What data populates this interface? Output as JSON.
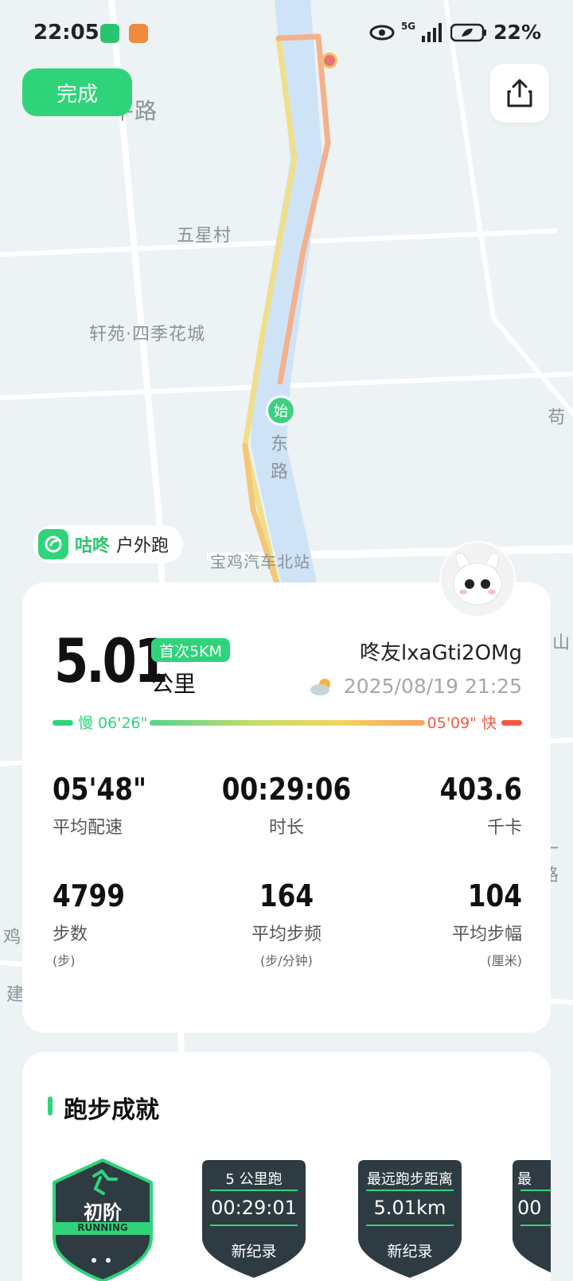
{
  "status_bar": {
    "time": "22:05",
    "network": "5G",
    "battery": "22%",
    "app_icon_1": "wechat-like-green-icon",
    "app_icon_2": "taobao-like-orange-icon"
  },
  "top": {
    "done_label": "完成",
    "share_icon": "share-icon"
  },
  "map": {
    "labels": [
      "平路",
      "五星村",
      "轩苑·四季花城",
      "东",
      "路",
      "宝鸡汽车北站",
      "苟",
      "山",
      "十路",
      "鸡",
      "建"
    ],
    "start_marker": "始"
  },
  "brand": {
    "name": "咕咚",
    "activity": "户外跑"
  },
  "summary": {
    "distance": "5.01",
    "badge": "首次5KM",
    "unit": "公里",
    "username": "咚友lxaGti2OMg",
    "datetime": "2025/08/19 21:25",
    "weather_icon": "partly-cloudy-icon",
    "pace_slow": "慢 06'26\"",
    "pace_fast": "05'09\" 快"
  },
  "stats": [
    {
      "value": "05'48\"",
      "label": "平均配速",
      "sub": ""
    },
    {
      "value": "00:29:06",
      "label": "时长",
      "sub": ""
    },
    {
      "value": "403.6",
      "label": "千卡",
      "sub": ""
    },
    {
      "value": "4799",
      "label": "步数",
      "sub": "(步)"
    },
    {
      "value": "164",
      "label": "平均步频",
      "sub": "(步/分钟)"
    },
    {
      "value": "104",
      "label": "平均步幅",
      "sub": "(厘米)"
    }
  ],
  "achievements": {
    "title": "跑步成就",
    "items": [
      {
        "top": "",
        "mid": "初阶",
        "bot": "RUNNING"
      },
      {
        "top": "5 公里跑",
        "mid": "00:29:01",
        "bot": "新纪录"
      },
      {
        "top": "最远跑步距离",
        "mid": "5.01km",
        "bot": "新纪录"
      },
      {
        "top": "最",
        "mid": "00",
        "bot": ""
      }
    ]
  },
  "colors": {
    "brand_green": "#2fd47a",
    "pace_fast": "#f25a43"
  }
}
